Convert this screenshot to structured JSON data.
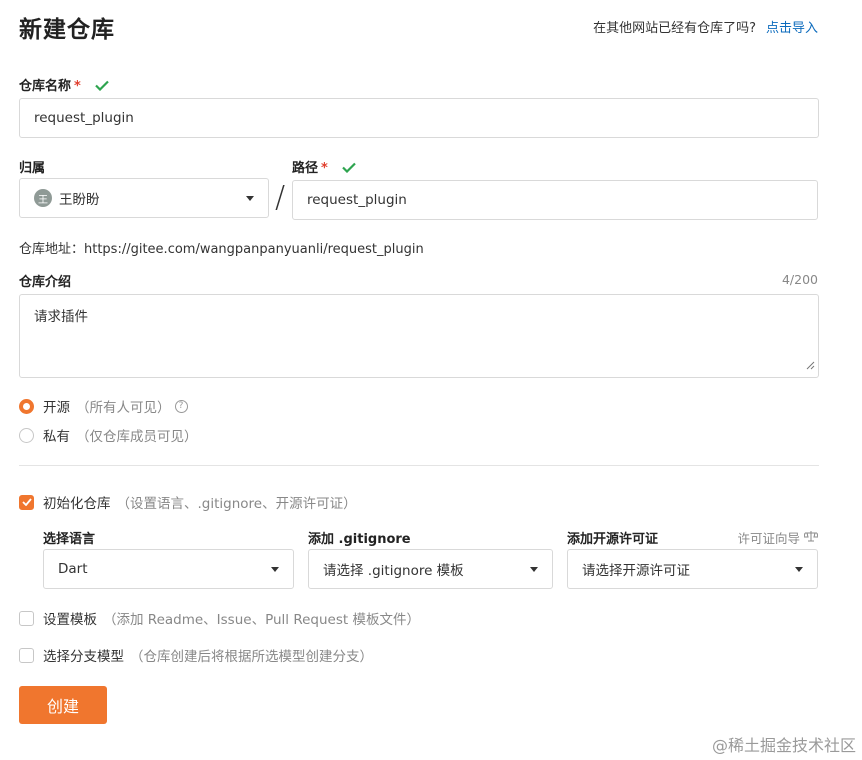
{
  "header": {
    "title": "新建仓库",
    "import_prompt": "在其他网站已经有仓库了吗?",
    "import_link": "点击导入"
  },
  "repo_name": {
    "label": "仓库名称",
    "required_mark": "*",
    "value": "request_plugin",
    "check_icon": "checkmark-icon"
  },
  "owner": {
    "label": "归属",
    "avatar_text": "王",
    "value": "王盼盼",
    "separator": "/"
  },
  "path": {
    "label": "路径",
    "required_mark": "*",
    "value": "request_plugin"
  },
  "repo_address": {
    "text": "仓库地址：https://gitee.com/wangpanpanyuanli/request_plugin"
  },
  "description": {
    "label": "仓库介绍",
    "counter": "4/200",
    "value": "请求插件"
  },
  "visibility": {
    "options": [
      {
        "label": "开源",
        "hint": "（所有人可见）",
        "selected": true
      },
      {
        "label": "私有",
        "hint": "（仅仓库成员可见）",
        "selected": false
      }
    ]
  },
  "init_repo": {
    "label": "初始化仓库",
    "hint": "（设置语言、.gitignore、开源许可证）",
    "checked": true
  },
  "language": {
    "label": "选择语言",
    "value": "Dart"
  },
  "gitignore": {
    "label": "添加 .gitignore",
    "value": "请选择 .gitignore 模板"
  },
  "license": {
    "label": "添加开源许可证",
    "guide": "许可证向导",
    "value": "请选择开源许可证"
  },
  "template": {
    "label": "设置模板",
    "hint": "（添加 Readme、Issue、Pull Request 模板文件）",
    "checked": false
  },
  "branch_model": {
    "label": "选择分支模型",
    "hint": "（仓库创建后将根据所选模型创建分支）",
    "checked": false
  },
  "create_button": "创建",
  "watermark": "@稀土掘金技术社区",
  "colors": {
    "accent": "#f0762e",
    "link": "#0c6bbd",
    "success": "#2ea44f"
  }
}
